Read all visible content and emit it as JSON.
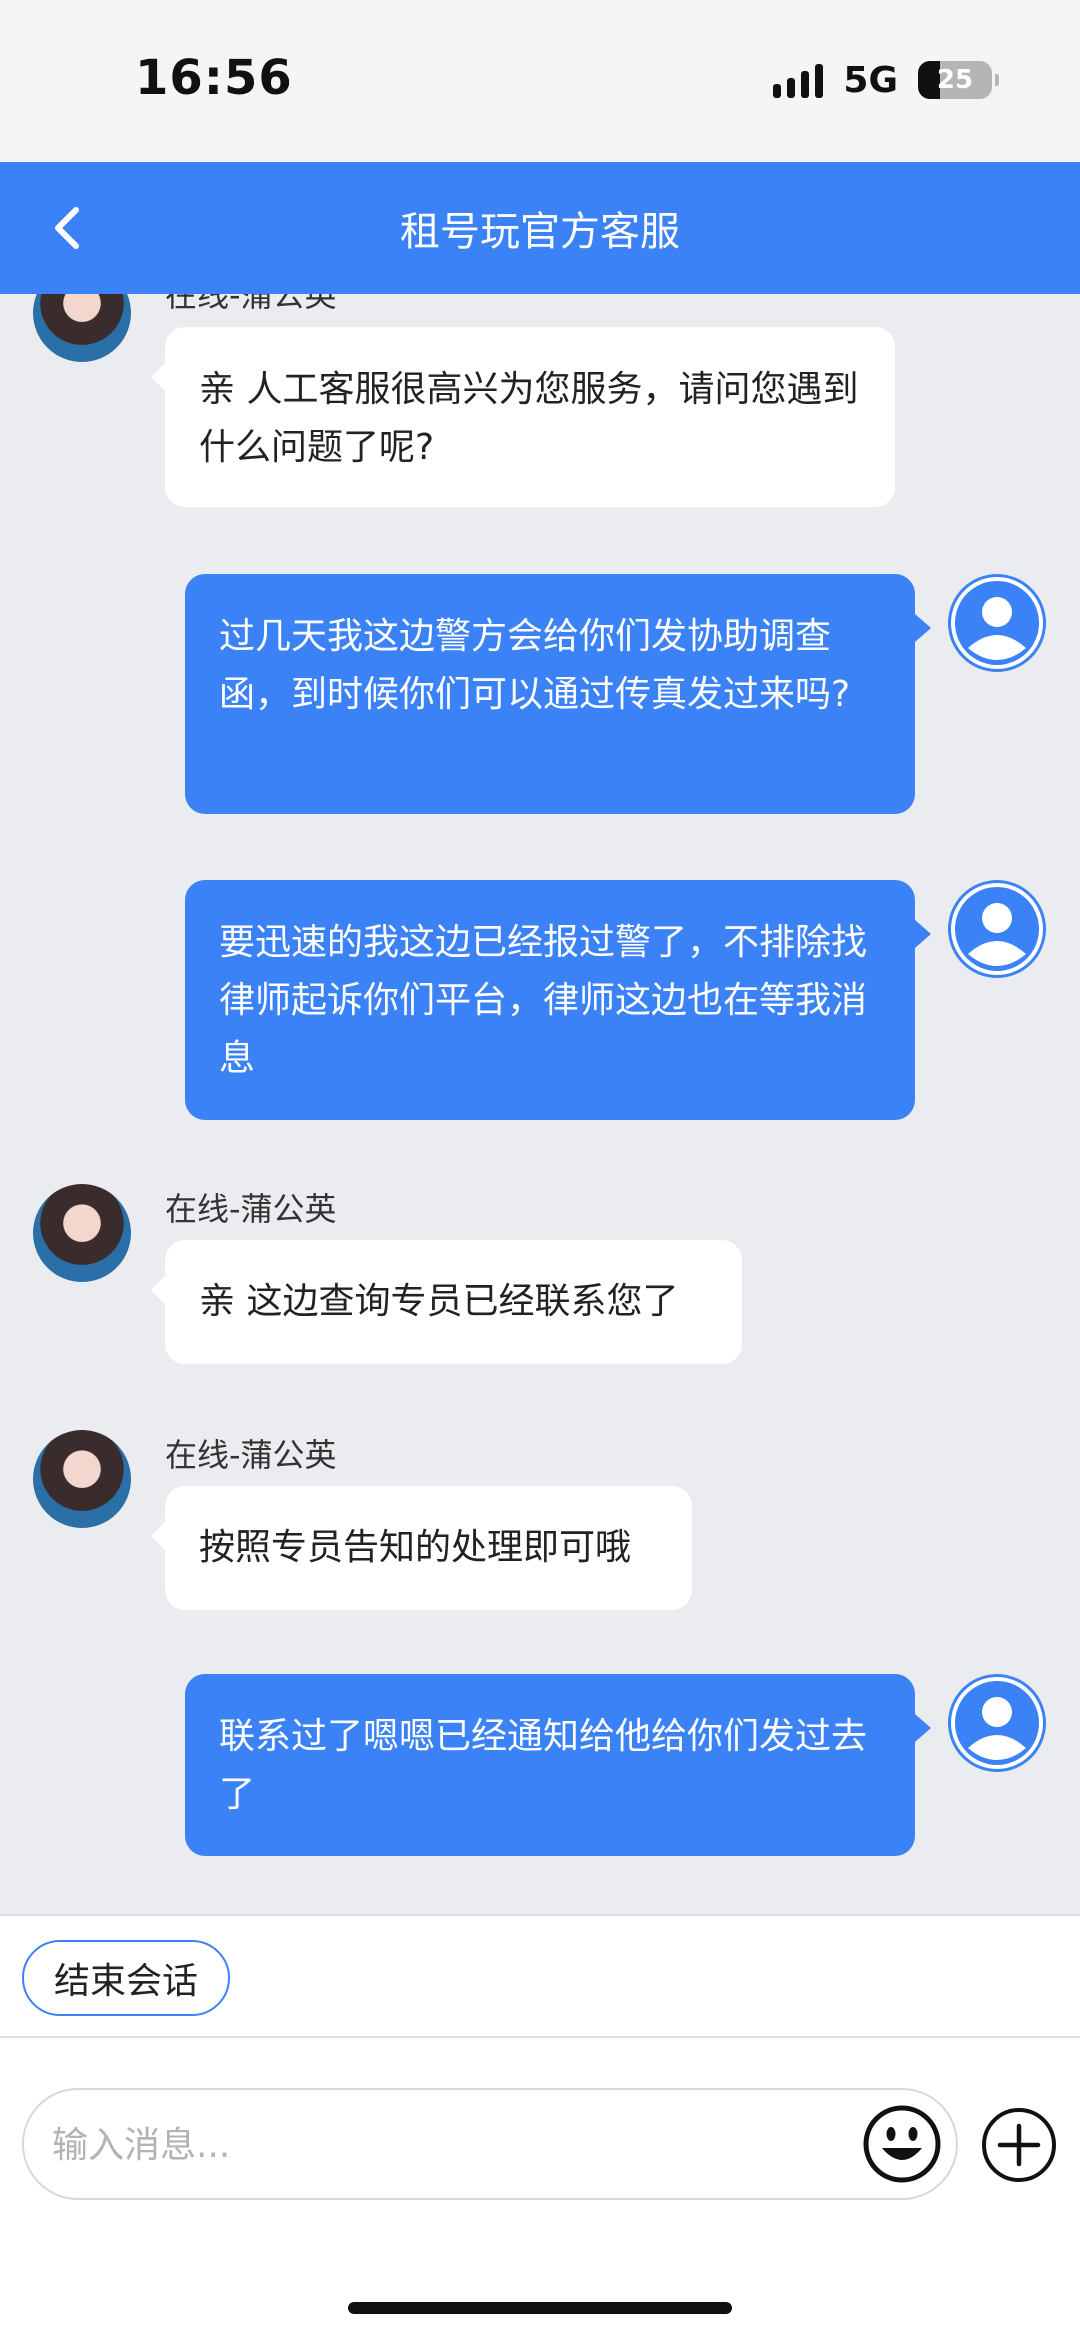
{
  "status_bar": {
    "time": "16:56",
    "network": "5G",
    "battery": "25"
  },
  "header": {
    "title": "租号玩官方客服",
    "back_icon": "chevron-left-icon"
  },
  "colors": {
    "accent": "#3b82f6",
    "chat_background": "#ebecef",
    "agent_bubble": "#ffffff"
  },
  "messages": [
    {
      "from": "agent",
      "sender": "在线-蒲公英",
      "text": "亲  人工客服很高兴为您服务，请问您遇到什么问题了呢?"
    },
    {
      "from": "user",
      "text": "过几天我这边警方会给你们发协助调查函，到时候你们可以通过传真发过来吗?"
    },
    {
      "from": "user",
      "text": "要迅速的我这边已经报过警了，不排除找律师起诉你们平台，律师这边也在等我消息"
    },
    {
      "from": "agent",
      "sender": "在线-蒲公英",
      "text": "亲 这边查询专员已经联系您了"
    },
    {
      "from": "agent",
      "sender": "在线-蒲公英",
      "text": "按照专员告知的处理即可哦"
    },
    {
      "from": "user",
      "text": "联系过了嗯嗯已经通知给他给你们发过去了"
    }
  ],
  "quick_actions": {
    "end_session": "结束会话"
  },
  "composer": {
    "placeholder": "输入消息...",
    "emoji_icon": "smiley-icon",
    "add_icon": "plus-circle-icon"
  }
}
